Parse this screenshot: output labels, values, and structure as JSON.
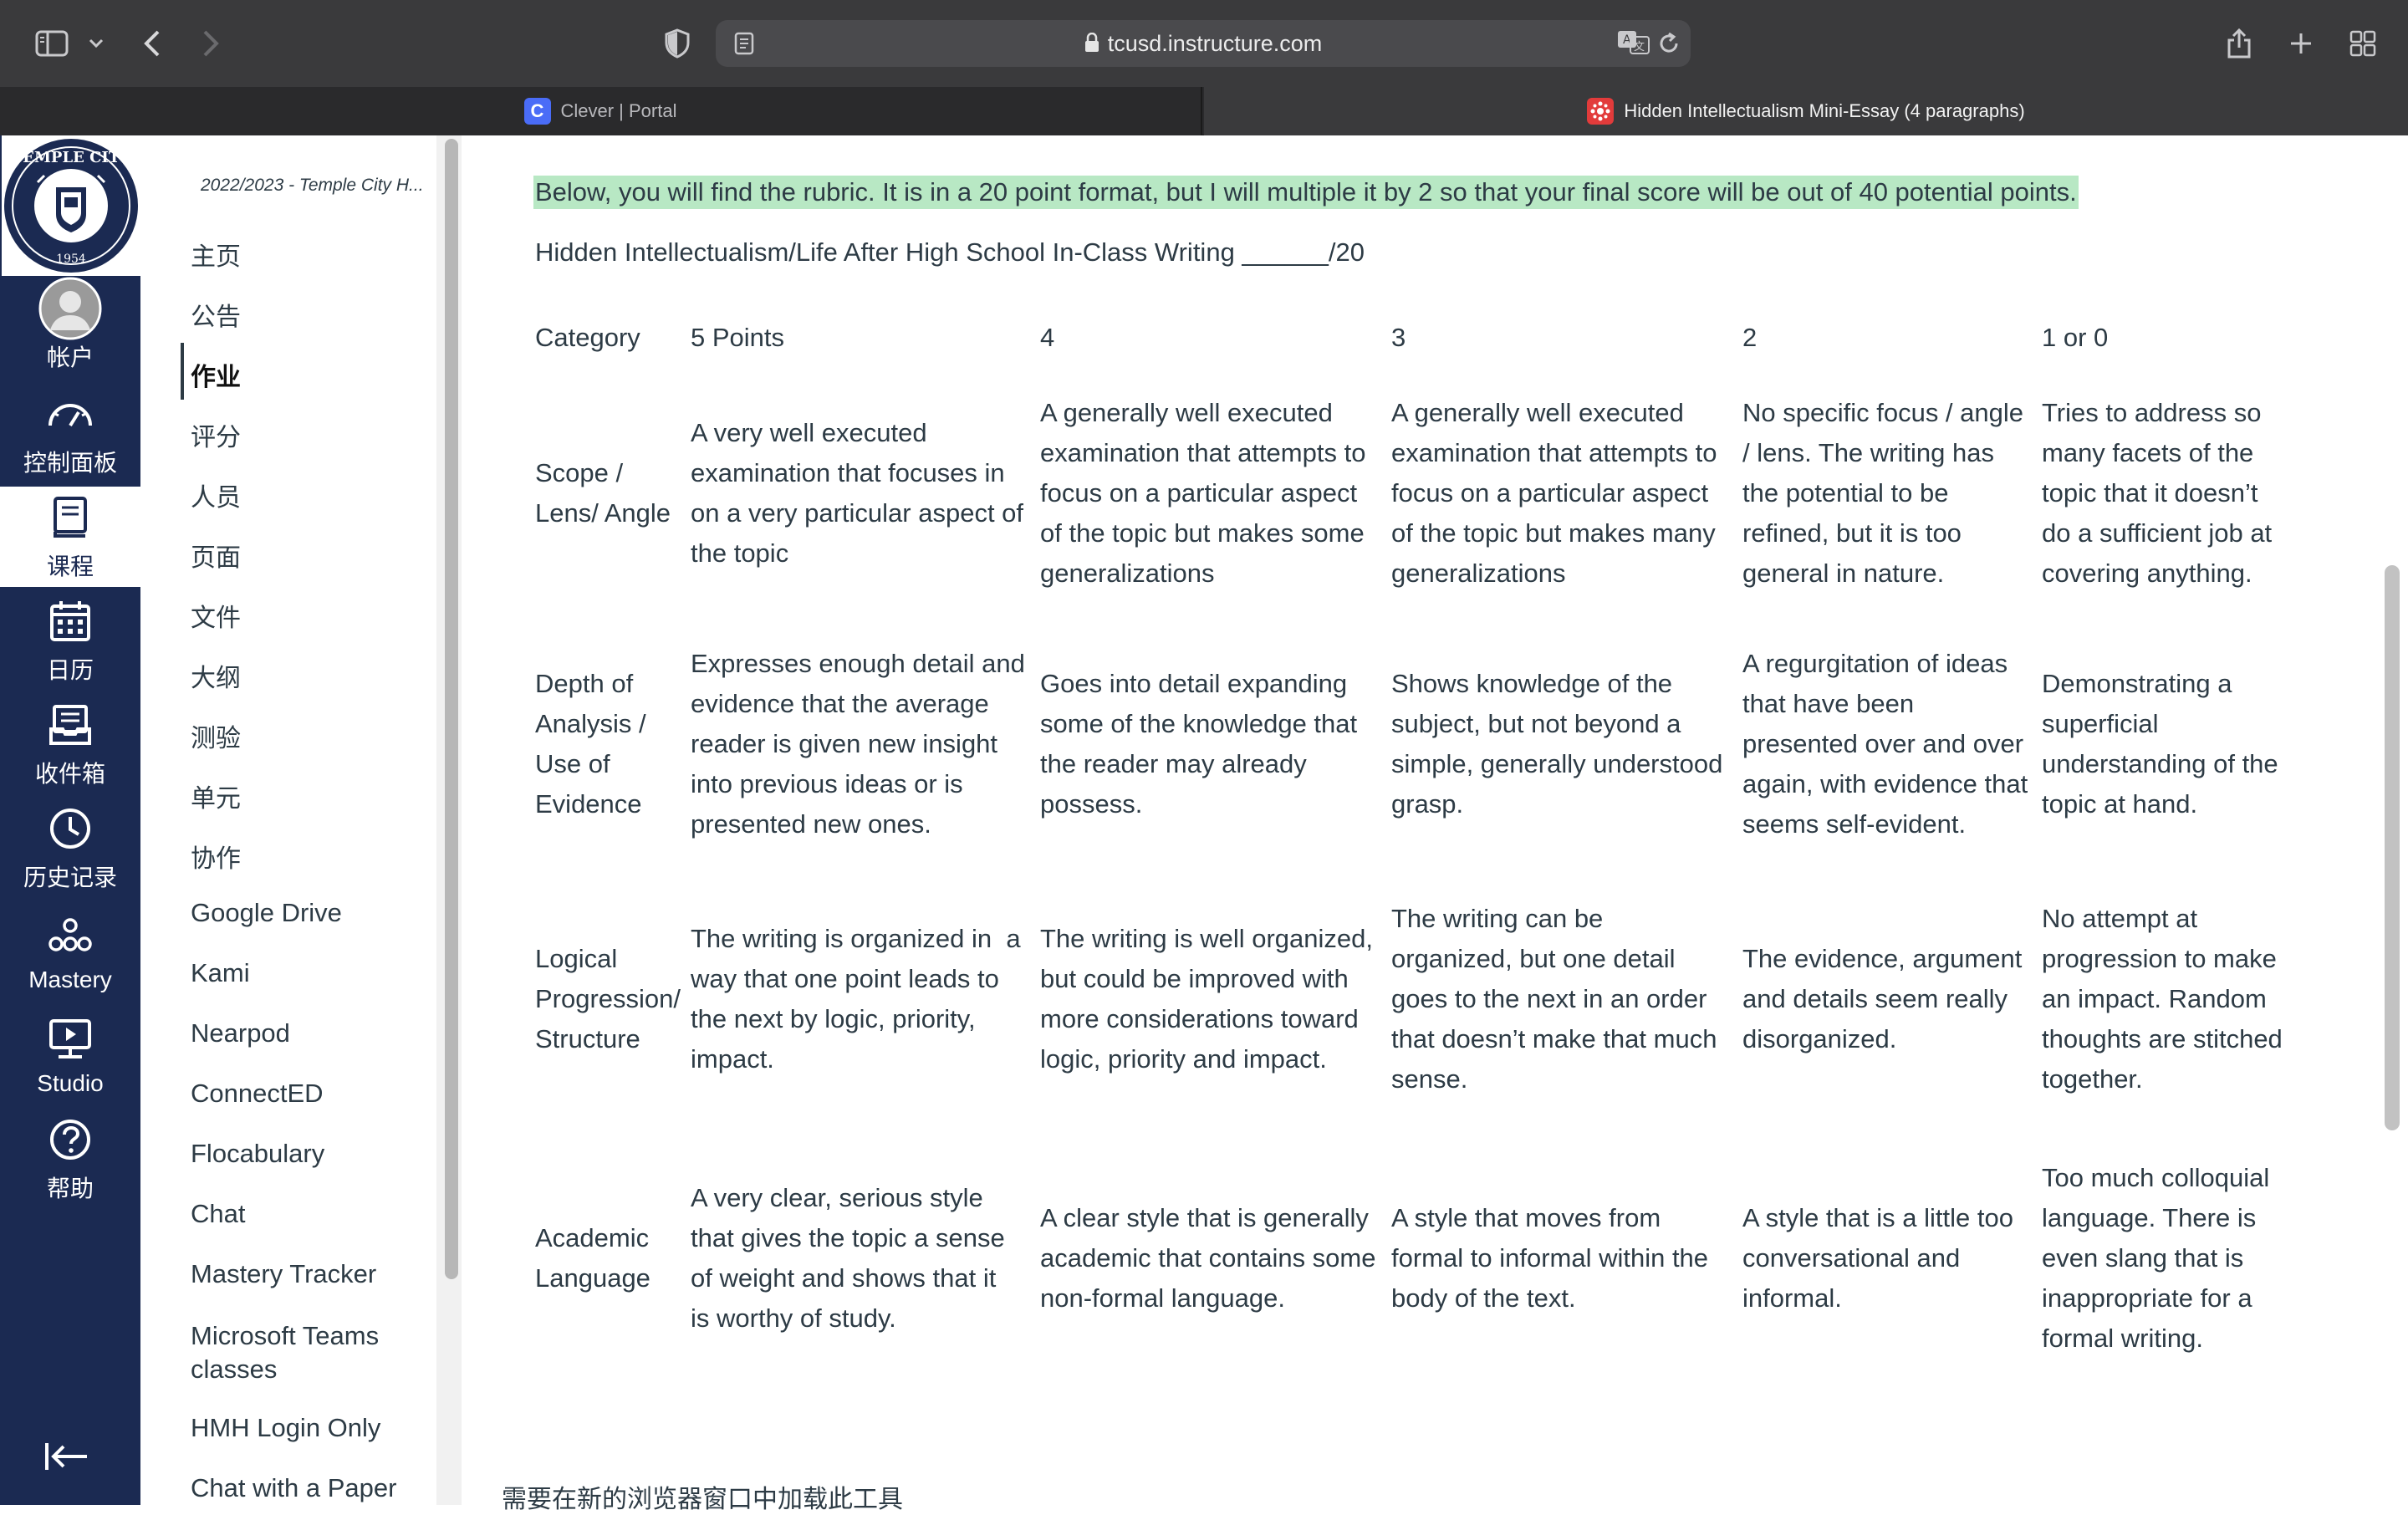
{
  "browser": {
    "url": "tcusd.instructure.com",
    "tabs": [
      {
        "label": "Clever | Portal",
        "icon": "clever-favicon",
        "active": false
      },
      {
        "label": "Hidden Intellectualism Mini-Essay (4 paragraphs)",
        "icon": "canvas-favicon",
        "active": true
      }
    ]
  },
  "global_nav": {
    "logo": {
      "text_top": "TEMPLE CITY",
      "year": "1954"
    },
    "items": [
      {
        "label": "帐户",
        "icon": "account-avatar-icon"
      },
      {
        "label": "控制面板",
        "icon": "dashboard-icon"
      },
      {
        "label": "课程",
        "icon": "courses-icon",
        "active": true
      },
      {
        "label": "日历",
        "icon": "calendar-icon"
      },
      {
        "label": "收件箱",
        "icon": "inbox-icon"
      },
      {
        "label": "历史记录",
        "icon": "history-icon"
      },
      {
        "label": "Mastery",
        "icon": "mastery-icon"
      },
      {
        "label": "Studio",
        "icon": "studio-icon"
      },
      {
        "label": "帮助",
        "icon": "help-icon"
      }
    ]
  },
  "course_nav": {
    "term": "2022/2023 - Temple City H...",
    "items": [
      {
        "label": "主页"
      },
      {
        "label": "公告"
      },
      {
        "label": "作业",
        "active": true
      },
      {
        "label": "评分"
      },
      {
        "label": "人员"
      },
      {
        "label": "页面"
      },
      {
        "label": "文件"
      },
      {
        "label": "大纲"
      },
      {
        "label": "测验"
      },
      {
        "label": "单元"
      },
      {
        "label": "协作"
      },
      {
        "label": "Google Drive"
      },
      {
        "label": "Kami"
      },
      {
        "label": "Nearpod"
      },
      {
        "label": "ConnectED"
      },
      {
        "label": "Flocabulary"
      },
      {
        "label": "Chat"
      },
      {
        "label": "Mastery Tracker"
      },
      {
        "label": "Microsoft Teams classes"
      },
      {
        "label": "HMH Login Only"
      },
      {
        "label": "Chat with a Paper"
      }
    ]
  },
  "content": {
    "intro": "Below, you will find the rubric. It is in a 20 point format, but I will multiple it by 2 so that your final score will be out of 40 potential points.",
    "subtitle": "Hidden Intellectualism/Life After High School In-Class Writing   ______/20",
    "rubric": {
      "headers": [
        "Category",
        "5 Points",
        "4",
        "3",
        "2",
        "1 or 0"
      ],
      "rows": [
        {
          "category": [
            "Scope /",
            "Lens/ Angle"
          ],
          "cells": [
            [
              "A very well executed",
              "examination that focuses in",
              "on a very particular aspect of",
              "the topic"
            ],
            [
              "A generally well executed",
              "examination that attempts to",
              "focus on a particular aspect",
              "of the topic but makes some",
              "generalizations"
            ],
            [
              "A generally well executed",
              "examination that attempts to",
              "focus on a particular aspect",
              "of the topic but makes many",
              "generalizations"
            ],
            [
              "No specific focus / angle",
              "/ lens. The writing has",
              "the potential to be",
              "refined, but it is too",
              "general in nature."
            ],
            [
              "Tries to address so",
              "many facets of the",
              "topic that it doesn’t",
              "do a sufficient job at",
              "covering anything."
            ]
          ]
        },
        {
          "category": [
            "Depth of",
            "Analysis /",
            "Use of",
            "Evidence"
          ],
          "cells": [
            [
              "Expresses enough detail and",
              "evidence that the average",
              "reader is given new insight",
              "into previous ideas or is",
              "presented new ones."
            ],
            [
              "Goes into detail expanding",
              "some of the knowledge that",
              "the reader may already",
              "possess."
            ],
            [
              "Shows knowledge of the",
              "subject, but not beyond a",
              "simple, generally understood",
              "grasp."
            ],
            [
              "A regurgitation of ideas",
              "that have been",
              "presented over and over",
              "again, with evidence that",
              "seems self-evident."
            ],
            [
              "Demonstrating a",
              "superficial",
              "understanding of the",
              "topic at hand."
            ]
          ]
        },
        {
          "category": [
            "Logical",
            "Progression/",
            "Structure"
          ],
          "cells": [
            [
              "The writing is organized in  a",
              "way that one point leads to",
              "the next by logic, priority,",
              "impact."
            ],
            [
              "The writing is well organized,",
              "but could be improved with",
              "more considerations toward",
              "logic, priority and impact."
            ],
            [
              "The writing can be",
              "organized, but one detail",
              "goes to the next in an order",
              "that doesn’t make that much",
              "sense."
            ],
            [
              "The evidence, argument",
              "and details seem really",
              "disorganized."
            ],
            [
              "No attempt at",
              "progression to make",
              "an impact. Random",
              "thoughts are stitched",
              "together."
            ]
          ]
        },
        {
          "category": [
            "Academic",
            "Language"
          ],
          "cells": [
            [
              "A very clear, serious style",
              "that gives the topic a sense",
              "of weight and shows that it",
              "is worthy of study."
            ],
            [
              "A clear style that is generally",
              "academic that contains some",
              "non-formal language."
            ],
            [
              "A style that moves from",
              "formal to informal within the",
              "body of the text."
            ],
            [
              "A style that is a little too",
              "conversational and",
              "informal."
            ],
            [
              "Too much colloquial",
              "language. There is",
              "even slang that is",
              "inappropriate for a",
              "formal writing."
            ]
          ]
        }
      ]
    },
    "bottom_note": "需要在新的浏览器窗口中加载此工具"
  }
}
